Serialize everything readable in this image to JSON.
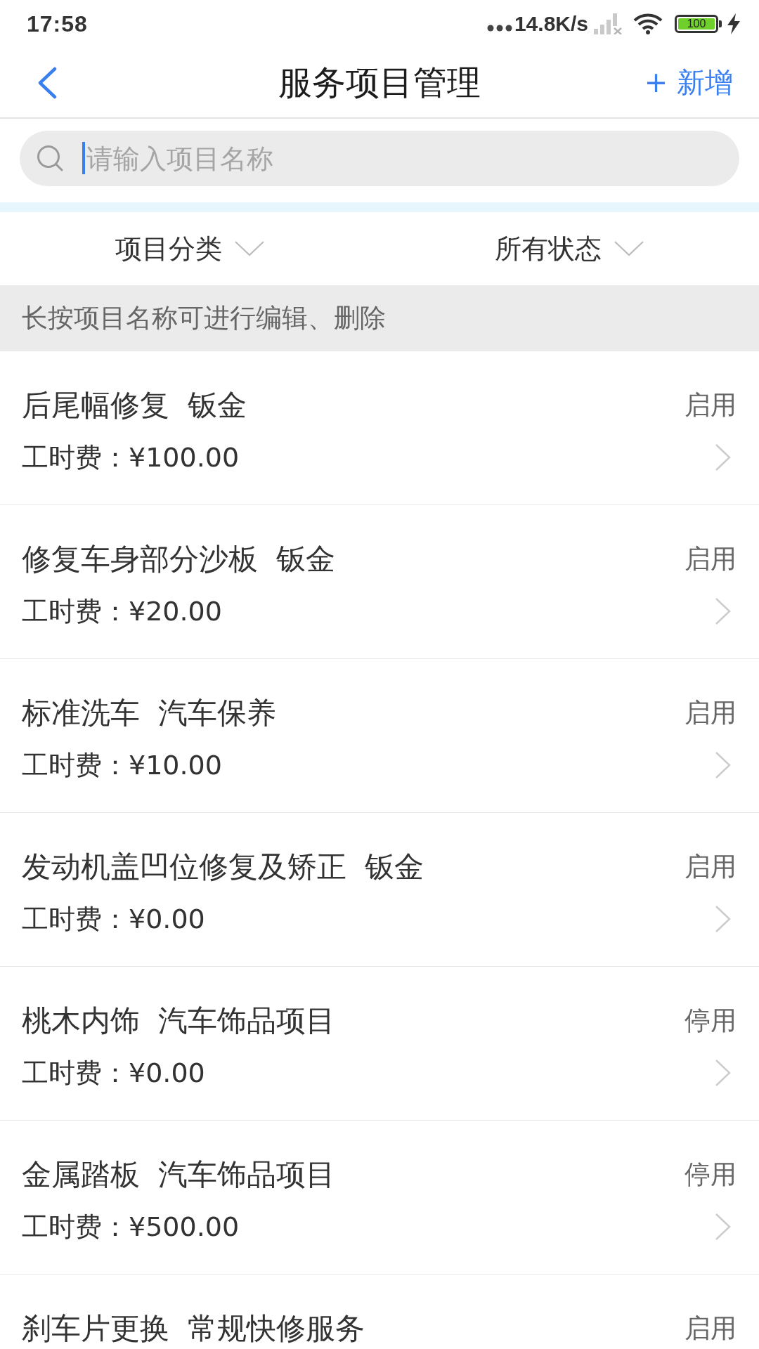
{
  "status_bar": {
    "time": "17:58",
    "net_speed": "14.8K/s",
    "battery": "100"
  },
  "nav": {
    "title": "服务项目管理",
    "action": "+ 新增"
  },
  "search": {
    "placeholder": "请输入项目名称"
  },
  "filters": [
    {
      "label": "项目分类"
    },
    {
      "label": "所有状态"
    }
  ],
  "hint": "长按项目名称可进行编辑、删除",
  "items": [
    {
      "name": "后尾幅修复",
      "category": "钣金",
      "price": "工时费：¥100.00",
      "status": "启用"
    },
    {
      "name": "修复车身部分沙板",
      "category": "钣金",
      "price": "工时费：¥20.00",
      "status": "启用"
    },
    {
      "name": "标准洗车",
      "category": "汽车保养",
      "price": "工时费：¥10.00",
      "status": "启用"
    },
    {
      "name": "发动机盖凹位修复及矫正",
      "category": "钣金",
      "price": "工时费：¥0.00",
      "status": "启用"
    },
    {
      "name": "桃木内饰",
      "category": "汽车饰品项目",
      "price": "工时费：¥0.00",
      "status": "停用"
    },
    {
      "name": "金属踏板",
      "category": "汽车饰品项目",
      "price": "工时费：¥500.00",
      "status": "停用"
    },
    {
      "name": "刹车片更换",
      "category": "常规快修服务",
      "status": "启用"
    }
  ]
}
